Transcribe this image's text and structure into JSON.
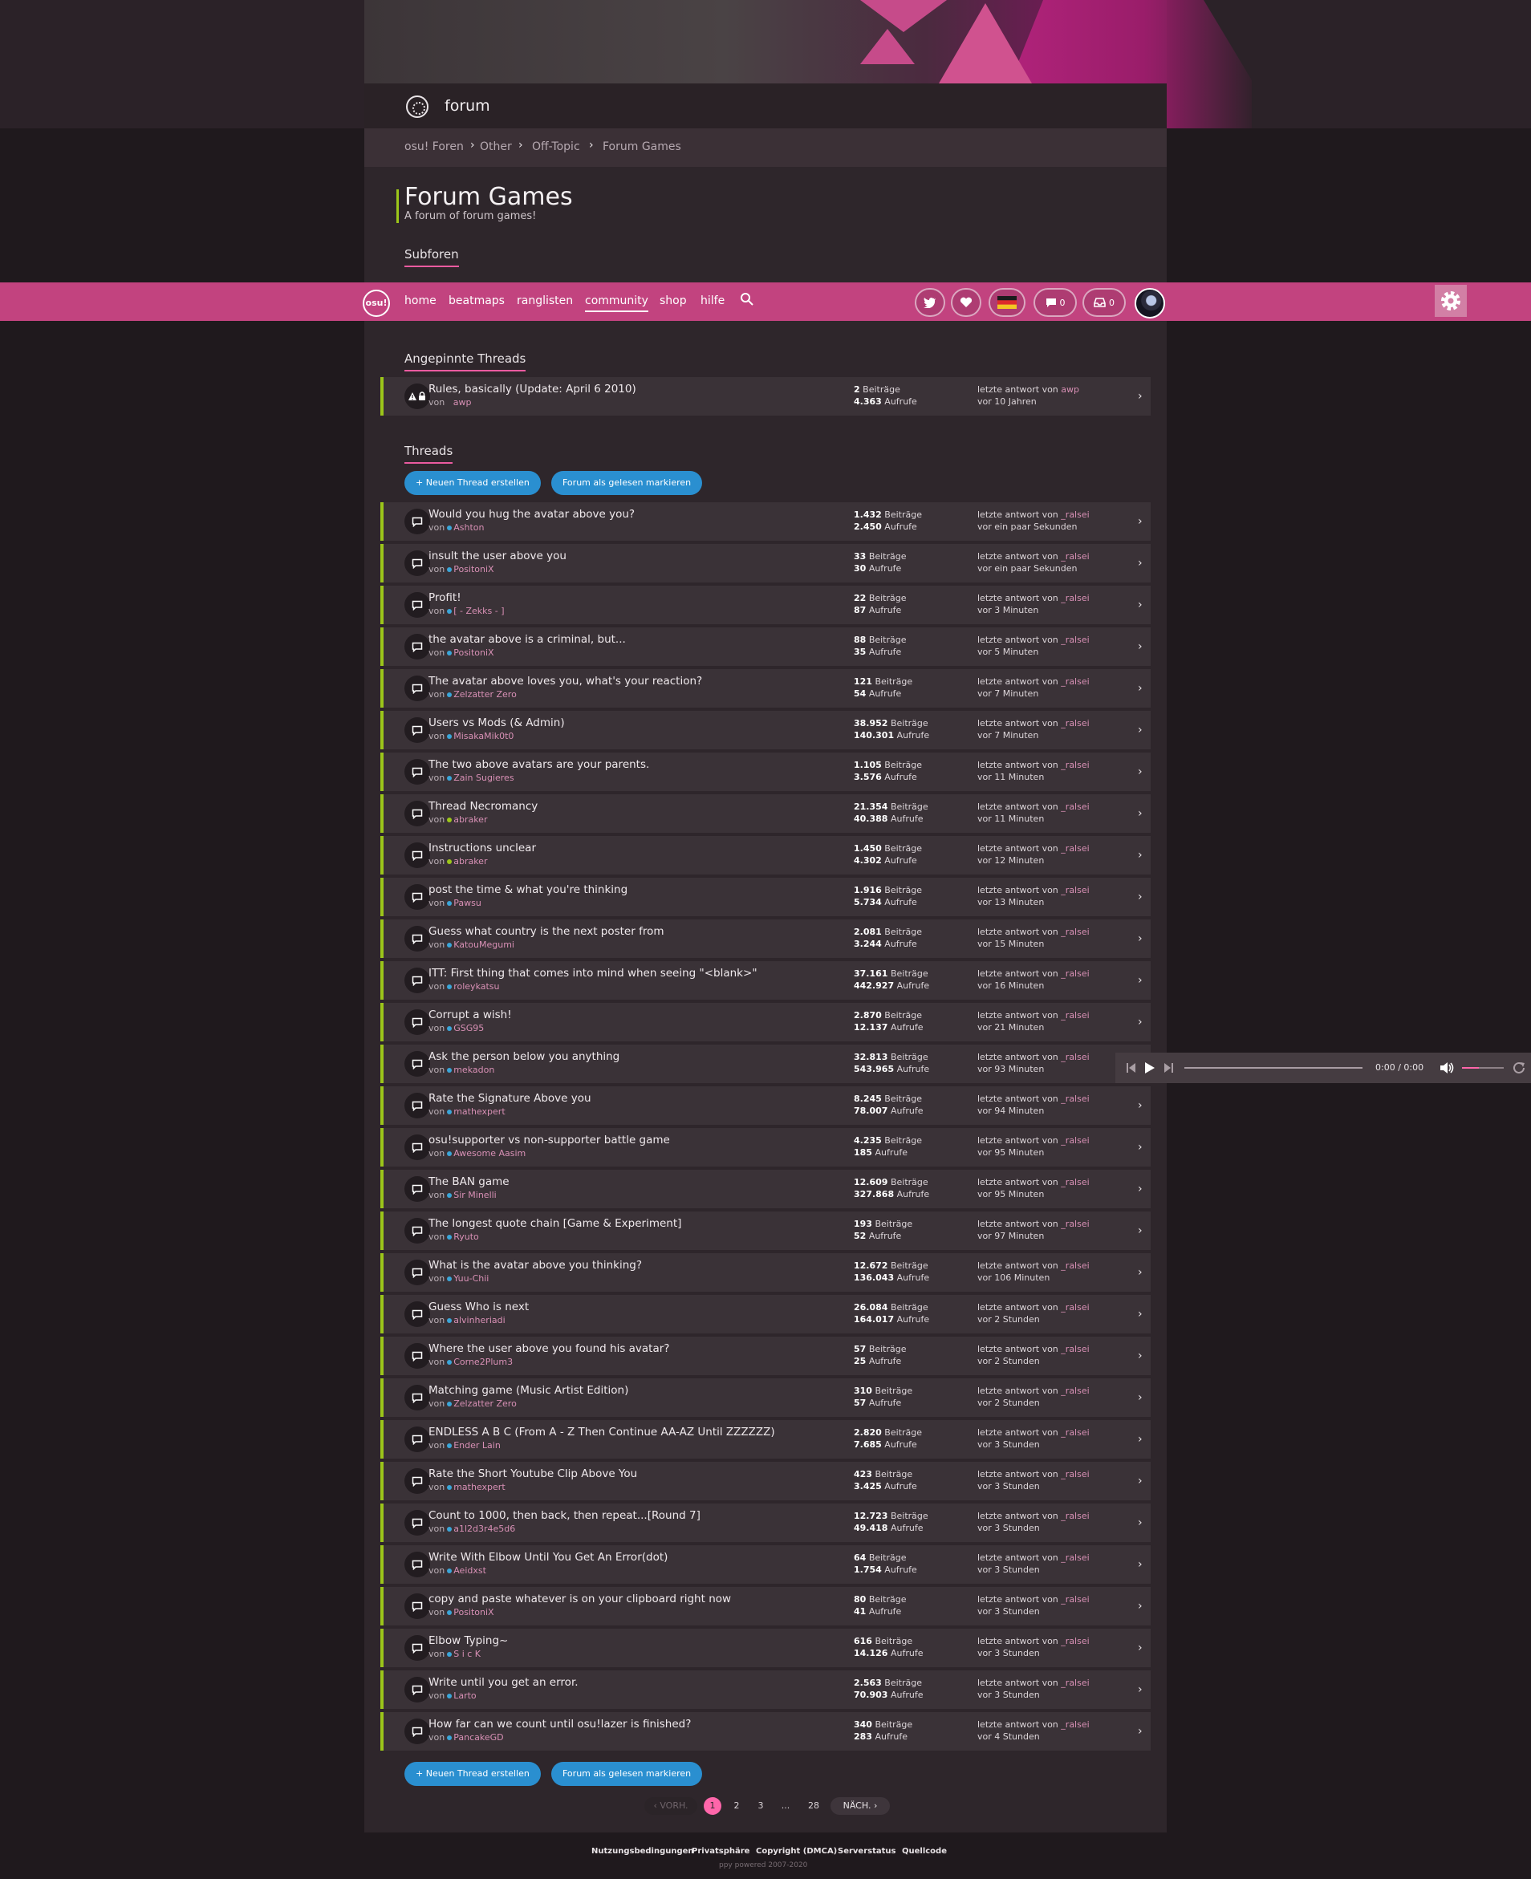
{
  "colors": {
    "accent_pink": "#ff66aa",
    "nav_pink": "#c2437f",
    "row_accent_green": "#9cc61a",
    "button_blue": "#2a8fd0"
  },
  "forum_bar": {
    "title": "forum",
    "icon": "forum-icon"
  },
  "breadcrumb": [
    "osu! Foren",
    "Other",
    "Off-Topic",
    "Forum Games"
  ],
  "page": {
    "title": "Forum Games",
    "subtitle": "A forum of forum games!"
  },
  "sections": {
    "subforums": "Subforen",
    "pinned": "Angepinnte Threads",
    "threads": "Threads"
  },
  "nav": {
    "logo": "osu!",
    "links": [
      {
        "label": "home"
      },
      {
        "label": "beatmaps"
      },
      {
        "label": "ranglisten"
      },
      {
        "label": "community",
        "active": true
      },
      {
        "label": "shop"
      },
      {
        "label": "hilfe"
      }
    ],
    "chat_count": "0",
    "notif_count": "0"
  },
  "actions": {
    "new_thread": "Neuen Thread erstellen",
    "mark_read": "Forum als gelesen markieren"
  },
  "pinned_threads": [
    {
      "title": "Rules, basically (Update: April 6 2010)",
      "by_prefix": "von",
      "author": "awp",
      "replies": "2",
      "views": "4.363",
      "last_prefix": "letzte antwort von",
      "last_user": "awp",
      "last_time": "vor 10 Jahren"
    }
  ],
  "labels": {
    "replies": "Beiträge",
    "views": "Aufrufe",
    "by": "von",
    "last": "letzte antwort von"
  },
  "threads": [
    {
      "title": "Would you hug the avatar above you?",
      "author": "Ashton",
      "dot": "#3aa5d8",
      "replies": "1.432",
      "views": "2.450",
      "last_user": "_ralsei",
      "last_time": "vor ein paar Sekunden"
    },
    {
      "title": "insult the user above you",
      "author": "PositoniX",
      "dot": "#3aa5d8",
      "replies": "33",
      "views": "30",
      "last_user": "_ralsei",
      "last_time": "vor ein paar Sekunden"
    },
    {
      "title": "Profit!",
      "author": "[ - Zekks - ]",
      "dot": "#3aa5d8",
      "replies": "22",
      "views": "87",
      "last_user": "_ralsei",
      "last_time": "vor 3 Minuten"
    },
    {
      "title": "the avatar above is a criminal, but...",
      "author": "PositoniX",
      "dot": "#3aa5d8",
      "replies": "88",
      "views": "35",
      "last_user": "_ralsei",
      "last_time": "vor 5 Minuten"
    },
    {
      "title": "The avatar above loves you, what's your reaction?",
      "author": "Zelzatter Zero",
      "dot": "#3aa5d8",
      "replies": "121",
      "views": "54",
      "last_user": "_ralsei",
      "last_time": "vor 7 Minuten"
    },
    {
      "title": "Users vs Mods (& Admin)",
      "author": "MisakaMik0t0",
      "dot": "#3aa5d8",
      "replies": "38.952",
      "views": "140.301",
      "last_user": "_ralsei",
      "last_time": "vor 7 Minuten"
    },
    {
      "title": "The two above avatars are your parents.",
      "author": "Zain Sugieres",
      "dot": "#3aa5d8",
      "replies": "1.105",
      "views": "3.576",
      "last_user": "_ralsei",
      "last_time": "vor 11 Minuten"
    },
    {
      "title": "Thread Necromancy",
      "author": "abraker",
      "dot": "#9cc61a",
      "replies": "21.354",
      "views": "40.388",
      "last_user": "_ralsei",
      "last_time": "vor 11 Minuten"
    },
    {
      "title": "Instructions unclear",
      "author": "abraker",
      "dot": "#9cc61a",
      "replies": "1.450",
      "views": "4.302",
      "last_user": "_ralsei",
      "last_time": "vor 12 Minuten"
    },
    {
      "title": "post the time & what you're thinking",
      "author": "Pawsu",
      "dot": "#3aa5d8",
      "replies": "1.916",
      "views": "5.734",
      "last_user": "_ralsei",
      "last_time": "vor 13 Minuten"
    },
    {
      "title": "Guess what country is the next poster from",
      "author": "KatouMegumi",
      "dot": "#3aa5d8",
      "replies": "2.081",
      "views": "3.244",
      "last_user": "_ralsei",
      "last_time": "vor 15 Minuten"
    },
    {
      "title": "ITT: First thing that comes into mind when seeing \"<blank>\"",
      "author": "roleykatsu",
      "dot": "#3aa5d8",
      "replies": "37.161",
      "views": "442.927",
      "last_user": "_ralsei",
      "last_time": "vor 16 Minuten"
    },
    {
      "title": "Corrupt a wish!",
      "author": "GSG95",
      "dot": "#3aa5d8",
      "replies": "2.870",
      "views": "12.137",
      "last_user": "_ralsei",
      "last_time": "vor 21 Minuten"
    },
    {
      "title": "Ask the person below you anything",
      "author": "mekadon",
      "dot": "#3aa5d8",
      "replies": "32.813",
      "views": "543.965",
      "last_user": "_ralsei",
      "last_time": "vor 93 Minuten"
    },
    {
      "title": "Rate the Signature Above you",
      "author": "mathexpert",
      "dot": "#3aa5d8",
      "replies": "8.245",
      "views": "78.007",
      "last_user": "_ralsei",
      "last_time": "vor 94 Minuten"
    },
    {
      "title": "osu!supporter vs non-supporter battle game",
      "author": "Awesome Aasim",
      "dot": "#3aa5d8",
      "replies": "4.235",
      "views": "185",
      "last_user": "_ralsei",
      "last_time": "vor 95 Minuten"
    },
    {
      "title": "The BAN game",
      "author": "Sir Minelli",
      "dot": "#3aa5d8",
      "replies": "12.609",
      "views": "327.868",
      "last_user": "_ralsei",
      "last_time": "vor 95 Minuten"
    },
    {
      "title": "The longest quote chain [Game & Experiment]",
      "author": "Ryuto",
      "dot": "#3aa5d8",
      "replies": "193",
      "views": "52",
      "last_user": "_ralsei",
      "last_time": "vor 97 Minuten"
    },
    {
      "title": "What is the avatar above you thinking?",
      "author": "Yuu-Chii",
      "dot": "#3aa5d8",
      "replies": "12.672",
      "views": "136.043",
      "last_user": "_ralsei",
      "last_time": "vor 106 Minuten"
    },
    {
      "title": "Guess Who is next",
      "author": "alvinheriadi",
      "dot": "#3aa5d8",
      "replies": "26.084",
      "views": "164.017",
      "last_user": "_ralsei",
      "last_time": "vor 2 Stunden"
    },
    {
      "title": "Where the user above you found his avatar?",
      "author": "Corne2Plum3",
      "dot": "#3aa5d8",
      "replies": "57",
      "views": "25",
      "last_user": "_ralsei",
      "last_time": "vor 2 Stunden"
    },
    {
      "title": "Matching game (Music Artist Edition)",
      "author": "Zelzatter Zero",
      "dot": "#3aa5d8",
      "replies": "310",
      "views": "57",
      "last_user": "_ralsei",
      "last_time": "vor 2 Stunden"
    },
    {
      "title": "ENDLESS A B C (From A - Z Then Continue AA-AZ Until ZZZZZZ)",
      "author": "Ender Lain",
      "dot": "#3aa5d8",
      "replies": "2.820",
      "views": "7.685",
      "last_user": "_ralsei",
      "last_time": "vor 3 Stunden"
    },
    {
      "title": "Rate the Short Youtube Clip Above You",
      "author": "mathexpert",
      "dot": "#3aa5d8",
      "replies": "423",
      "views": "3.425",
      "last_user": "_ralsei",
      "last_time": "vor 3 Stunden"
    },
    {
      "title": "Count to 1000, then back, then repeat...[Round 7]",
      "author": "a1l2d3r4e5d6",
      "dot": "#3aa5d8",
      "replies": "12.723",
      "views": "49.418",
      "last_user": "_ralsei",
      "last_time": "vor 3 Stunden"
    },
    {
      "title": "Write With Elbow Until You Get An Error(dot)",
      "author": "Aeidxst",
      "dot": "#3aa5d8",
      "replies": "64",
      "views": "1.754",
      "last_user": "_ralsei",
      "last_time": "vor 3 Stunden"
    },
    {
      "title": "copy and paste whatever is on your clipboard right now",
      "author": "PositoniX",
      "dot": "#3aa5d8",
      "replies": "80",
      "views": "41",
      "last_user": "_ralsei",
      "last_time": "vor 3 Stunden"
    },
    {
      "title": "Elbow Typing~",
      "author": "S i c K",
      "dot": "#3aa5d8",
      "replies": "616",
      "views": "14.126",
      "last_user": "_ralsei",
      "last_time": "vor 3 Stunden"
    },
    {
      "title": "Write until you get an error.",
      "author": "Larto",
      "dot": "#3aa5d8",
      "replies": "2.563",
      "views": "70.903",
      "last_user": "_ralsei",
      "last_time": "vor 3 Stunden"
    },
    {
      "title": "How far can we count until osu!lazer is finished?",
      "author": "PancakeGD",
      "dot": "#3aa5d8",
      "replies": "340",
      "views": "283",
      "last_user": "_ralsei",
      "last_time": "vor 4 Stunden"
    }
  ],
  "pagination": {
    "prev": "VORH.",
    "next": "NÄCH.",
    "pages": [
      "1",
      "2",
      "3",
      "...",
      "28"
    ],
    "current": "1"
  },
  "player": {
    "time": "0:00 /  0:00",
    "volume_fraction": 0.4
  },
  "footer": {
    "links": [
      "Nutzungsbedingungen",
      "Privatsphäre",
      "Copyright (DMCA)",
      "Serverstatus",
      "Quellcode"
    ],
    "copyright": "ppy powered 2007-2020"
  }
}
